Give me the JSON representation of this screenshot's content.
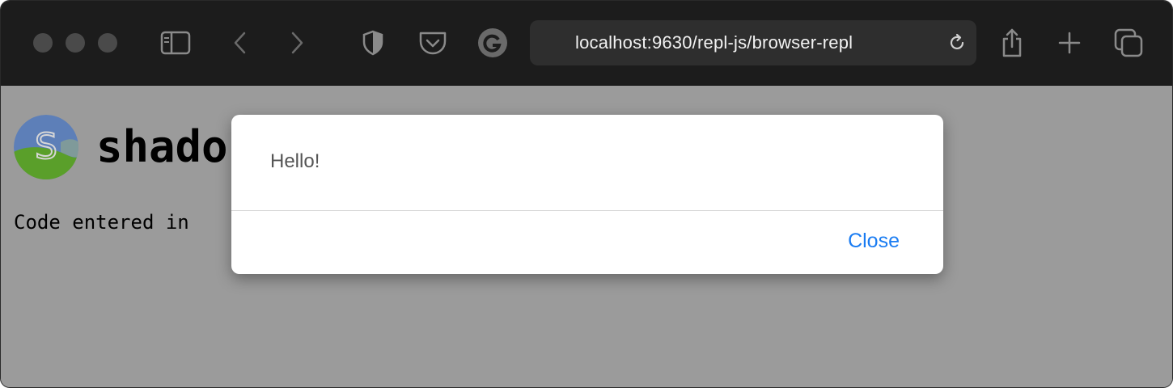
{
  "browser": {
    "url": "localhost:9630/repl-js/browser-repl",
    "icons": {
      "sidebar": "sidebar-icon",
      "back": "chevron-left-icon",
      "forward": "chevron-right-icon",
      "privacy": "shield-icon",
      "pocket": "pocket-icon",
      "grammarly": "g-extension-icon",
      "reload": "reload-icon",
      "share": "share-icon",
      "new_tab": "plus-icon",
      "tabs": "tabs-overview-icon"
    }
  },
  "page": {
    "logo_letter": "S",
    "heading": "shado",
    "paragraph": "Code entered in"
  },
  "dialog": {
    "message": "Hello!",
    "close_label": "Close"
  },
  "colors": {
    "toolbar": "#1c1c1c",
    "overlay": "#9b9b9b",
    "accent": "#1a7cf2"
  }
}
